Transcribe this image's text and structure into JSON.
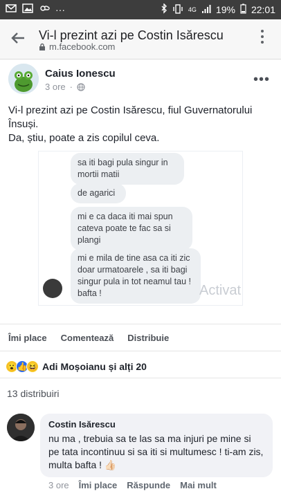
{
  "status_bar": {
    "battery": "19%",
    "time": "22:01",
    "network": "4G"
  },
  "browser": {
    "page_title": "Vi-l prezint azi pe Costin Isărescu",
    "url": "m.facebook.com"
  },
  "post": {
    "author": "Caius Ionescu",
    "time": "3 ore",
    "text_line1": "Vi-l prezint azi pe Costin Isărescu, fiul Guvernatorului Însuși.",
    "text_line2": "Da, știu, poate a zis copilul ceva.",
    "image": {
      "messages": [
        "sa iti bagi pula singur in mortii matii",
        "de agarici",
        "mi e ca daca iti mai spun cateva poate te fac sa si plangi",
        "mi e mila de tine asa ca iti zic doar urmatoarele , sa iti bagi singur pula in tot neamul tau ! bafta !"
      ],
      "watermark": "Activat"
    },
    "actions": {
      "like": "Îmi place",
      "comment": "Comentează",
      "share": "Distribuie"
    },
    "reactions": {
      "icons": [
        "wow-icon",
        "like-icon",
        "haha-icon"
      ],
      "label": "Adi Moșoianu și alți 20"
    },
    "shares": "13 distribuiri"
  },
  "comment": {
    "author": "Costin Isărescu",
    "text": "nu ma , trebuia sa te las sa ma injuri pe mine si pe tata incontinuu si sa iti si multumesc ! ti-am zis, multa bafta ! 👍🏻",
    "time": "3 ore",
    "like": "Îmi place",
    "reply": "Răspunde",
    "more": "Mai mult"
  },
  "colors": {
    "status_bar_bg": "#3d3d3d",
    "header_bg": "#f7f7f7",
    "bubble_bg": "#f1f2f6",
    "text": "#1d2129",
    "muted": "#90949c"
  }
}
